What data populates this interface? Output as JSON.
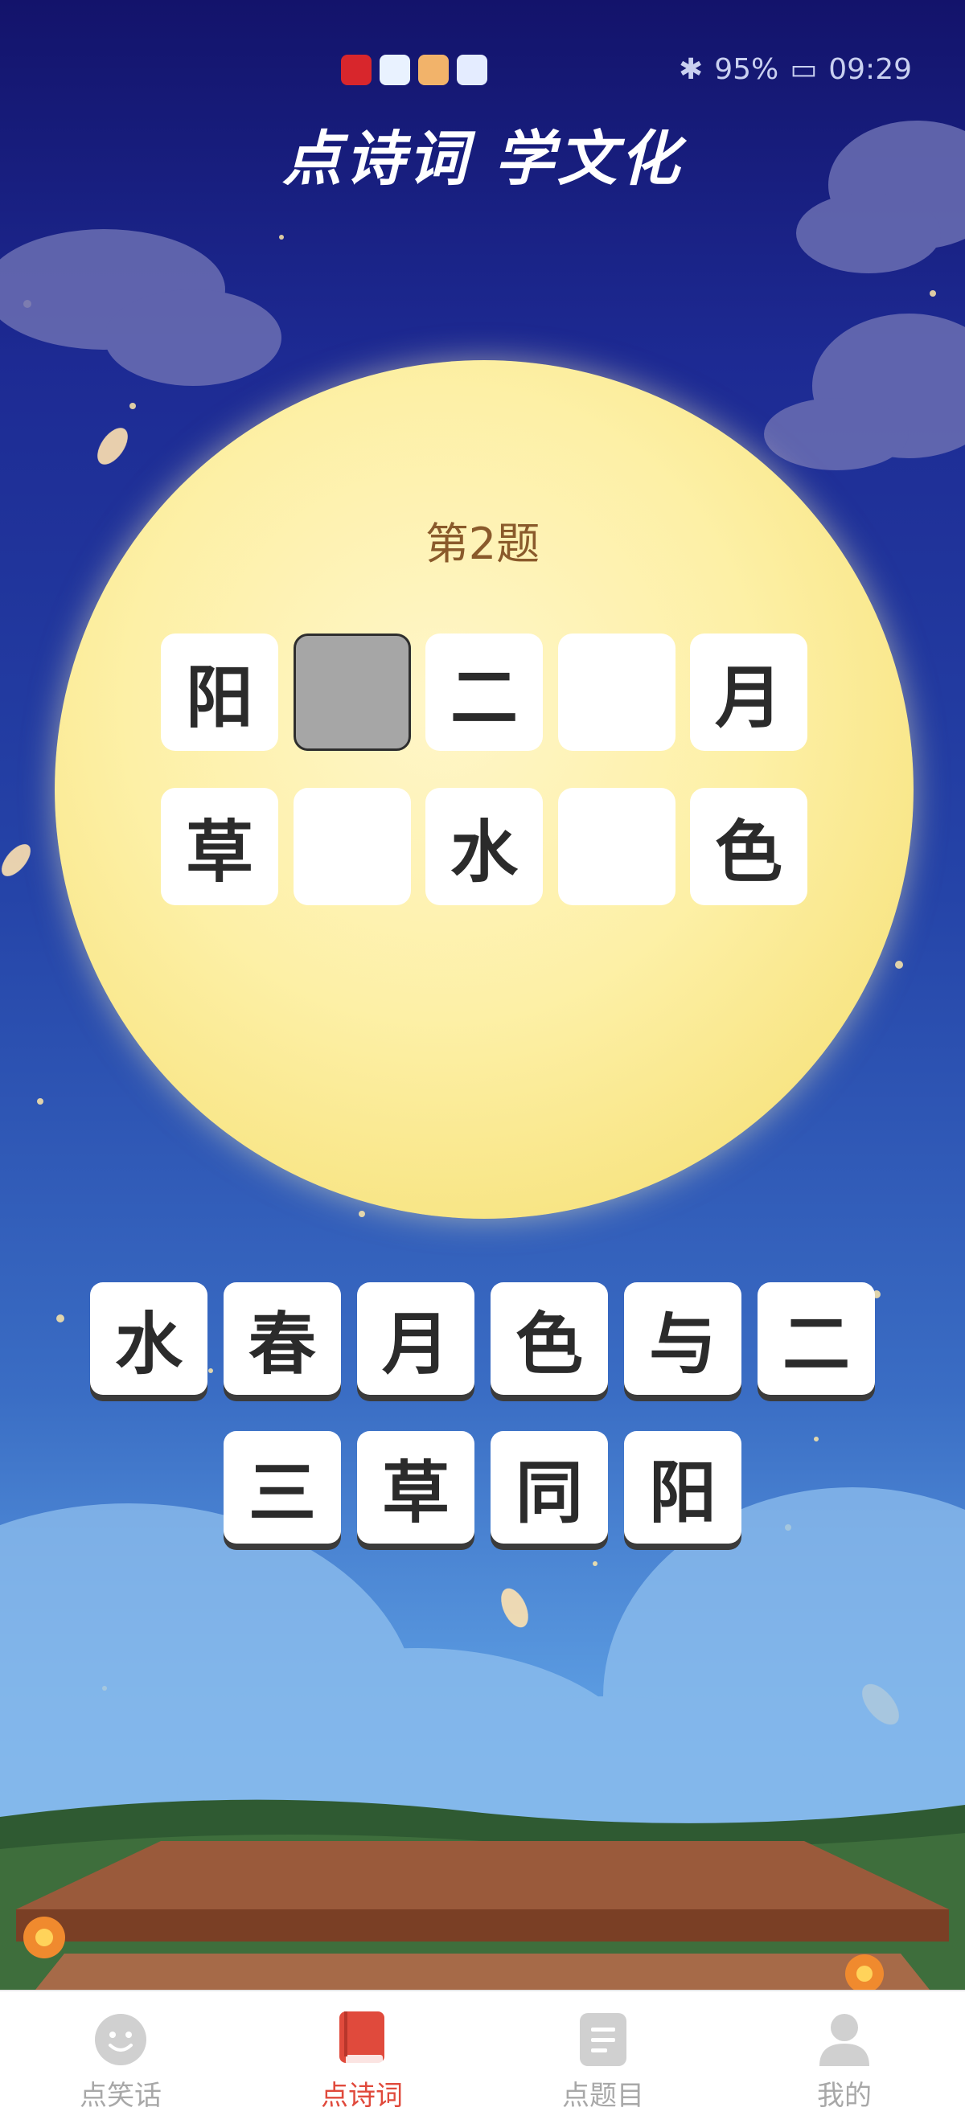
{
  "status_bar": {
    "battery": "95%",
    "time": "09:29"
  },
  "header": {
    "title": "点诗词  学文化"
  },
  "question": {
    "label": "第2题"
  },
  "grid": {
    "row1": [
      "阳",
      "",
      "二",
      "",
      "月"
    ],
    "row2": [
      "草",
      "",
      "水",
      "",
      "色"
    ],
    "selected_cell": "row1-2"
  },
  "choices": {
    "row1": [
      "水",
      "春",
      "月",
      "色",
      "与",
      "二"
    ],
    "row2": [
      "三",
      "草",
      "同",
      "阳"
    ]
  },
  "tabs": [
    {
      "label": "点笑话",
      "icon": "smiley-icon",
      "active": false
    },
    {
      "label": "点诗词",
      "icon": "book-icon",
      "active": true
    },
    {
      "label": "点题目",
      "icon": "document-icon",
      "active": false
    },
    {
      "label": "我的",
      "icon": "user-icon",
      "active": false
    }
  ],
  "colors": {
    "accent": "#e04a3c",
    "inactive": "#a8a8a8",
    "moon": "#fdf0a6",
    "sky": "#1d2a93"
  }
}
